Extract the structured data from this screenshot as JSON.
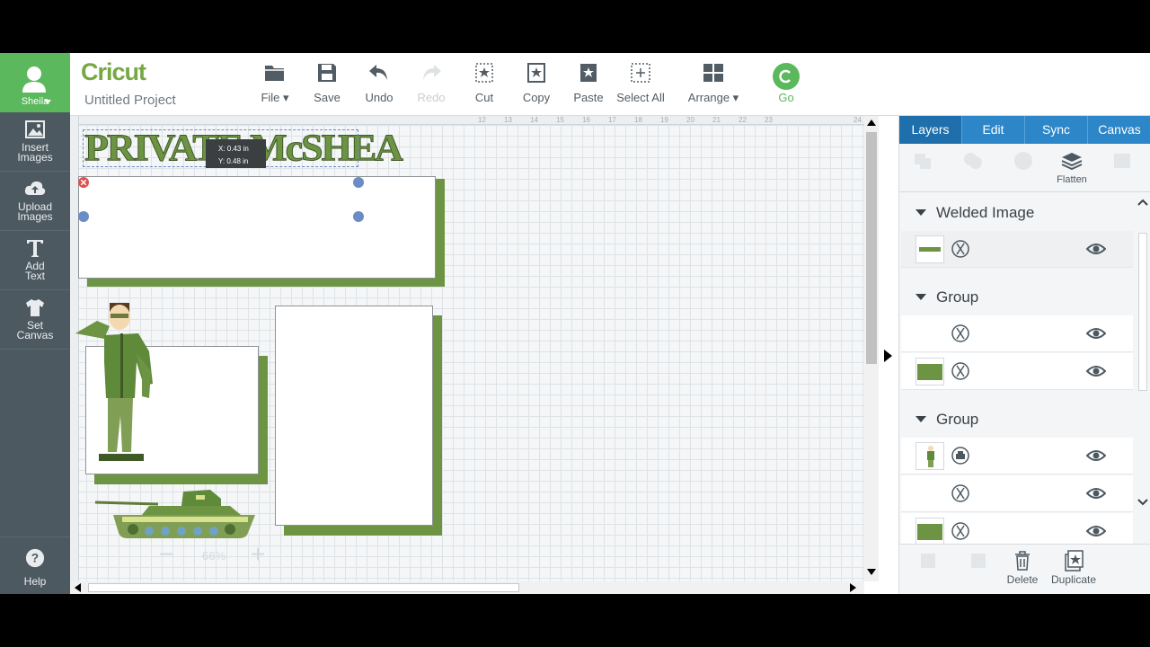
{
  "user": {
    "name": "Sheila"
  },
  "sidebar": {
    "items": [
      {
        "label": "Insert\nImages",
        "icon": "image-icon"
      },
      {
        "label": "Upload\nImages",
        "icon": "cloud-upload-icon"
      },
      {
        "label": "Add\nText",
        "icon": "text-icon"
      },
      {
        "label": "Set\nCanvas",
        "icon": "shirt-icon"
      }
    ],
    "help": "Help"
  },
  "header": {
    "logo": "Cricut",
    "project_title": "Untitled Project",
    "tools": {
      "file": "File",
      "save": "Save",
      "undo": "Undo",
      "redo": "Redo",
      "cut": "Cut",
      "copy": "Copy",
      "paste": "Paste",
      "select_all": "Select All",
      "arrange": "Arrange",
      "go": "Go"
    }
  },
  "canvas": {
    "title_text": "PRIVATE McSHEA",
    "position_tooltip": {
      "x": "X: 0.43 in",
      "y": "Y: 0.48 in"
    },
    "zoom": "66%",
    "ruler_top": [
      "12",
      "13",
      "14",
      "15",
      "16",
      "17",
      "18",
      "19",
      "20",
      "21",
      "22",
      "23",
      "24"
    ],
    "colors": {
      "mat_green": "#6c9443",
      "accent_green": "#5cb85c"
    }
  },
  "panel": {
    "tabs": [
      "Layers",
      "Edit",
      "Sync",
      "Canvas"
    ],
    "active_tab": "Layers",
    "tools": {
      "flatten": "Flatten",
      "delete": "Delete",
      "duplicate": "Duplicate"
    },
    "groups": [
      {
        "name": "Welded Image"
      },
      {
        "name": "Group"
      },
      {
        "name": "Group"
      }
    ]
  }
}
